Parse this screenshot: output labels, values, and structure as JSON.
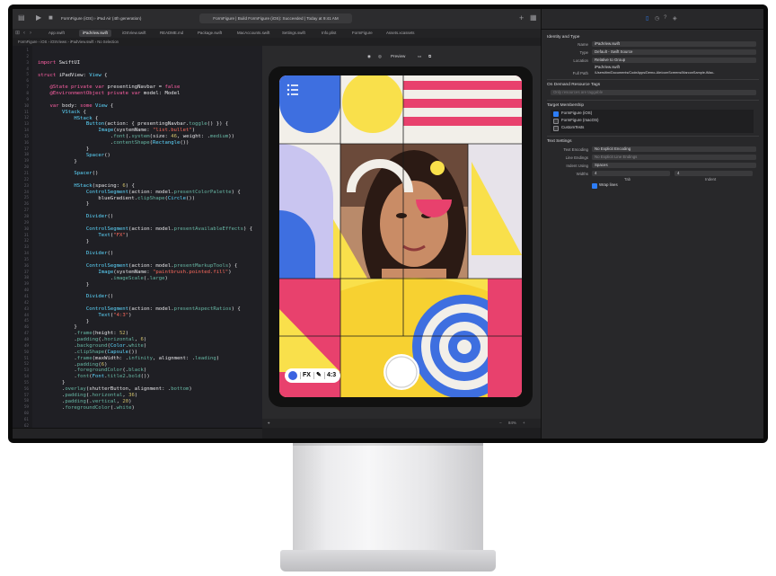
{
  "toolbar": {
    "target": "FormFigure (iOS)  ›  iPad Air (4th generation)",
    "status": "FormFigure | Build FormFigure (iOS): Succeeded | Today at 9:41 AM",
    "plus": "+"
  },
  "tabs": [
    "App.swift",
    "iPadView.swift",
    "iOSView.swift",
    "README.md",
    "Package.swift",
    "MacAccounts.swift",
    "Settings.swift",
    "Info.plist",
    "FormFigure",
    "Assets.xcassets"
  ],
  "breadcrumb": "FormFigure  ›  iOS  ›  iOSViews  ›  iPadView.swift  ›  No Selection",
  "code": [
    {
      "n": "1",
      "h": []
    },
    {
      "n": "2",
      "h": []
    },
    {
      "n": "3",
      "h": [
        [
          "k",
          "import"
        ],
        [
          "p",
          " SwiftUI"
        ]
      ]
    },
    {
      "n": "4",
      "h": []
    },
    {
      "n": "5",
      "h": [
        [
          "k",
          "struct"
        ],
        [
          "p",
          " iPadView: "
        ],
        [
          "t",
          "View"
        ],
        [
          "p",
          " {"
        ]
      ]
    },
    {
      "n": "6",
      "h": []
    },
    {
      "n": "7",
      "h": [
        [
          "p",
          "    "
        ],
        [
          "k",
          "@State private var"
        ],
        [
          "p",
          " presentingNavbar = "
        ],
        [
          "k",
          "false"
        ]
      ]
    },
    {
      "n": "8",
      "h": [
        [
          "p",
          "    "
        ],
        [
          "k",
          "@EnvironmentObject private var"
        ],
        [
          "p",
          " model: Model"
        ]
      ]
    },
    {
      "n": "9",
      "h": []
    },
    {
      "n": "10",
      "h": [
        [
          "p",
          "    "
        ],
        [
          "k",
          "var"
        ],
        [
          "p",
          " body: "
        ],
        [
          "k",
          "some"
        ],
        [
          "p",
          " "
        ],
        [
          "t",
          "View"
        ],
        [
          "p",
          " {"
        ]
      ]
    },
    {
      "n": "11",
      "h": [
        [
          "p",
          "        "
        ],
        [
          "t",
          "VStack"
        ],
        [
          "p",
          " {"
        ]
      ]
    },
    {
      "n": "12",
      "h": [
        [
          "p",
          "            "
        ],
        [
          "t",
          "HStack"
        ],
        [
          "p",
          " {"
        ]
      ]
    },
    {
      "n": "13",
      "h": [
        [
          "p",
          "                "
        ],
        [
          "t",
          "Button"
        ],
        [
          "p",
          "(action: { presentingNavbar."
        ],
        [
          "f",
          "toggle"
        ],
        [
          "p",
          "() }) {"
        ]
      ]
    },
    {
      "n": "14",
      "h": [
        [
          "p",
          "                    "
        ],
        [
          "t",
          "Image"
        ],
        [
          "p",
          "(systemName: "
        ],
        [
          "s",
          "\"list.bullet\""
        ],
        [
          "p",
          ")"
        ]
      ]
    },
    {
      "n": "15",
      "h": [
        [
          "p",
          "                        ."
        ],
        [
          "f",
          "font"
        ],
        [
          "p",
          "(."
        ],
        [
          "f",
          "system"
        ],
        [
          "p",
          "(size: "
        ],
        [
          "n",
          "46"
        ],
        [
          "p",
          ", weight: ."
        ],
        [
          "f",
          "medium"
        ],
        [
          "p",
          "))"
        ]
      ]
    },
    {
      "n": "16",
      "h": [
        [
          "p",
          "                        ."
        ],
        [
          "f",
          "contentShape"
        ],
        [
          "p",
          "("
        ],
        [
          "t",
          "Rectangle"
        ],
        [
          "p",
          "())"
        ]
      ]
    },
    {
      "n": "17",
      "h": [
        [
          "p",
          "                }"
        ]
      ]
    },
    {
      "n": "18",
      "h": [
        [
          "p",
          "                "
        ],
        [
          "t",
          "Spacer"
        ],
        [
          "p",
          "()"
        ]
      ]
    },
    {
      "n": "19",
      "h": [
        [
          "p",
          "            }"
        ]
      ]
    },
    {
      "n": "20",
      "h": []
    },
    {
      "n": "21",
      "h": [
        [
          "p",
          "            "
        ],
        [
          "t",
          "Spacer"
        ],
        [
          "p",
          "()"
        ]
      ]
    },
    {
      "n": "22",
      "h": []
    },
    {
      "n": "23",
      "h": [
        [
          "p",
          "            "
        ],
        [
          "t",
          "HStack"
        ],
        [
          "p",
          "(spacing: "
        ],
        [
          "n",
          "6"
        ],
        [
          "p",
          ") {"
        ]
      ]
    },
    {
      "n": "24",
      "h": [
        [
          "p",
          "                "
        ],
        [
          "t",
          "ControlSegment"
        ],
        [
          "p",
          "(action: model."
        ],
        [
          "f",
          "presentColorPalette"
        ],
        [
          "p",
          ") {"
        ]
      ]
    },
    {
      "n": "25",
      "h": [
        [
          "p",
          "                    blueGradient."
        ],
        [
          "f",
          "clipShape"
        ],
        [
          "p",
          "("
        ],
        [
          "t",
          "Circle"
        ],
        [
          "p",
          "())"
        ]
      ]
    },
    {
      "n": "26",
      "h": [
        [
          "p",
          "                }"
        ]
      ]
    },
    {
      "n": "27",
      "h": []
    },
    {
      "n": "28",
      "h": [
        [
          "p",
          "                "
        ],
        [
          "t",
          "Divider"
        ],
        [
          "p",
          "()"
        ]
      ]
    },
    {
      "n": "29",
      "h": []
    },
    {
      "n": "30",
      "h": [
        [
          "p",
          "                "
        ],
        [
          "t",
          "ControlSegment"
        ],
        [
          "p",
          "(action: model."
        ],
        [
          "f",
          "presentAvailableEffects"
        ],
        [
          "p",
          ") {"
        ]
      ]
    },
    {
      "n": "31",
      "h": [
        [
          "p",
          "                    "
        ],
        [
          "t",
          "Text"
        ],
        [
          "p",
          "("
        ],
        [
          "s",
          "\"FX\""
        ],
        [
          "p",
          ")"
        ]
      ]
    },
    {
      "n": "32",
      "h": [
        [
          "p",
          "                }"
        ]
      ]
    },
    {
      "n": "33",
      "h": []
    },
    {
      "n": "34",
      "h": [
        [
          "p",
          "                "
        ],
        [
          "t",
          "Divider"
        ],
        [
          "p",
          "()"
        ]
      ]
    },
    {
      "n": "35",
      "h": []
    },
    {
      "n": "36",
      "h": [
        [
          "p",
          "                "
        ],
        [
          "t",
          "ControlSegment"
        ],
        [
          "p",
          "(action: model."
        ],
        [
          "f",
          "presentMarkupTools"
        ],
        [
          "p",
          ") {"
        ]
      ]
    },
    {
      "n": "37",
      "h": [
        [
          "p",
          "                    "
        ],
        [
          "t",
          "Image"
        ],
        [
          "p",
          "(systemName: "
        ],
        [
          "s",
          "\"paintbrush.pointed.fill\""
        ],
        [
          "p",
          ")"
        ]
      ]
    },
    {
      "n": "38",
      "h": [
        [
          "p",
          "                        ."
        ],
        [
          "f",
          "imageScale"
        ],
        [
          "p",
          "(."
        ],
        [
          "f",
          "large"
        ],
        [
          "p",
          ")"
        ]
      ]
    },
    {
      "n": "39",
      "h": [
        [
          "p",
          "                }"
        ]
      ]
    },
    {
      "n": "40",
      "h": []
    },
    {
      "n": "41",
      "h": [
        [
          "p",
          "                "
        ],
        [
          "t",
          "Divider"
        ],
        [
          "p",
          "()"
        ]
      ]
    },
    {
      "n": "42",
      "h": []
    },
    {
      "n": "43",
      "h": [
        [
          "p",
          "                "
        ],
        [
          "t",
          "ControlSegment"
        ],
        [
          "p",
          "(action: model."
        ],
        [
          "f",
          "presentAspectRatios"
        ],
        [
          "p",
          ") {"
        ]
      ]
    },
    {
      "n": "44",
      "h": [
        [
          "p",
          "                    "
        ],
        [
          "t",
          "Text"
        ],
        [
          "p",
          "("
        ],
        [
          "s",
          "\"4:3\""
        ],
        [
          "p",
          ")"
        ]
      ]
    },
    {
      "n": "45",
      "h": [
        [
          "p",
          "                }"
        ]
      ]
    },
    {
      "n": "46",
      "h": [
        [
          "p",
          "            }"
        ]
      ]
    },
    {
      "n": "47",
      "h": [
        [
          "p",
          "            ."
        ],
        [
          "f",
          "frame"
        ],
        [
          "p",
          "(height: "
        ],
        [
          "n",
          "52"
        ],
        [
          "p",
          ")"
        ]
      ]
    },
    {
      "n": "48",
      "h": [
        [
          "p",
          "            ."
        ],
        [
          "f",
          "padding"
        ],
        [
          "p",
          "(."
        ],
        [
          "f",
          "horizontal"
        ],
        [
          "p",
          ", "
        ],
        [
          "n",
          "6"
        ],
        [
          "p",
          ")"
        ]
      ]
    },
    {
      "n": "49",
      "h": [
        [
          "p",
          "            ."
        ],
        [
          "f",
          "background"
        ],
        [
          "p",
          "("
        ],
        [
          "t",
          "Color"
        ],
        [
          "p",
          "."
        ],
        [
          "f",
          "white"
        ],
        [
          "p",
          ")"
        ]
      ]
    },
    {
      "n": "50",
      "h": [
        [
          "p",
          "            ."
        ],
        [
          "f",
          "clipShape"
        ],
        [
          "p",
          "("
        ],
        [
          "t",
          "Capsule"
        ],
        [
          "p",
          "())"
        ]
      ]
    },
    {
      "n": "51",
      "h": [
        [
          "p",
          "            ."
        ],
        [
          "f",
          "frame"
        ],
        [
          "p",
          "(maxWidth: ."
        ],
        [
          "f",
          "infinity"
        ],
        [
          "p",
          ", alignment: ."
        ],
        [
          "f",
          "leading"
        ],
        [
          "p",
          ")"
        ]
      ]
    },
    {
      "n": "52",
      "h": [
        [
          "p",
          "            ."
        ],
        [
          "f",
          "padding"
        ],
        [
          "p",
          "("
        ],
        [
          "n",
          "6"
        ],
        [
          "p",
          ")"
        ]
      ]
    },
    {
      "n": "53",
      "h": [
        [
          "p",
          "            ."
        ],
        [
          "f",
          "foregroundColor"
        ],
        [
          "p",
          "(."
        ],
        [
          "f",
          "black"
        ],
        [
          "p",
          ")"
        ]
      ]
    },
    {
      "n": "54",
      "h": [
        [
          "p",
          "            ."
        ],
        [
          "f",
          "font"
        ],
        [
          "p",
          "("
        ],
        [
          "t",
          "Font"
        ],
        [
          "p",
          "."
        ],
        [
          "f",
          "title2"
        ],
        [
          "p",
          "."
        ],
        [
          "f",
          "bold"
        ],
        [
          "p",
          "())"
        ]
      ]
    },
    {
      "n": "55",
      "h": [
        [
          "p",
          "        }"
        ]
      ]
    },
    {
      "n": "56",
      "h": [
        [
          "p",
          "        ."
        ],
        [
          "f",
          "overlay"
        ],
        [
          "p",
          "(shutterButton, alignment: ."
        ],
        [
          "f",
          "bottom"
        ],
        [
          "p",
          ")"
        ]
      ]
    },
    {
      "n": "57",
      "h": [
        [
          "p",
          "        ."
        ],
        [
          "f",
          "padding"
        ],
        [
          "p",
          "(."
        ],
        [
          "f",
          "horizontal"
        ],
        [
          "p",
          ", "
        ],
        [
          "n",
          "36"
        ],
        [
          "p",
          ")"
        ]
      ]
    },
    {
      "n": "58",
      "h": [
        [
          "p",
          "        ."
        ],
        [
          "f",
          "padding"
        ],
        [
          "p",
          "(."
        ],
        [
          "f",
          "vertical"
        ],
        [
          "p",
          ", "
        ],
        [
          "n",
          "20"
        ],
        [
          "p",
          ")"
        ]
      ]
    },
    {
      "n": "59",
      "h": [
        [
          "p",
          "        ."
        ],
        [
          "f",
          "foregroundColor"
        ],
        [
          "p",
          "(."
        ],
        [
          "f",
          "white"
        ],
        [
          "p",
          ")"
        ]
      ]
    },
    {
      "n": "60",
      "h": []
    },
    {
      "n": "61",
      "h": []
    },
    {
      "n": "62",
      "h": []
    }
  ],
  "canvas": {
    "preview_label": "Preview",
    "zoom": "84%",
    "fx_label": "FX",
    "ratio_label": "4:3"
  },
  "inspector": {
    "identity_title": "Identity and Type",
    "name_label": "Name",
    "name_value": "iPadView.swift",
    "type_label": "Type",
    "type_value": "Default - Swift Source",
    "location_label": "Location",
    "location_value": "Relative to Group",
    "location_path": "iPadView.swift",
    "fullpath_label": "Full Path",
    "fullpath_value": "/Users/tim/Documents/CodeApps/Demo-Ale/comScreens/MarconSample-iMac-iPad/iOS/iOSViews/iPadView.swift",
    "ondemand_title": "On Demand Resource Tags",
    "ondemand_placeholder": "Only resources are taggable",
    "target_title": "Target Membership",
    "targets": [
      {
        "label": "FormFigure (iOS)",
        "checked": true
      },
      {
        "label": "FormFigure (macOS)",
        "checked": false
      },
      {
        "label": "CustomTests",
        "checked": false
      }
    ],
    "text_title": "Text Settings",
    "encoding_label": "Text Encoding",
    "encoding_value": "No Explicit Encoding",
    "endings_label": "Line Endings",
    "endings_value": "No Explicit Line Endings",
    "indent_label": "Indent Using",
    "indent_value": "Spaces",
    "widths_label": "Widths",
    "tab_value": "4",
    "indent_value_num": "4",
    "tab_label": "Tab",
    "indent_label2": "Indent",
    "wrap_label": "Wrap lines"
  }
}
